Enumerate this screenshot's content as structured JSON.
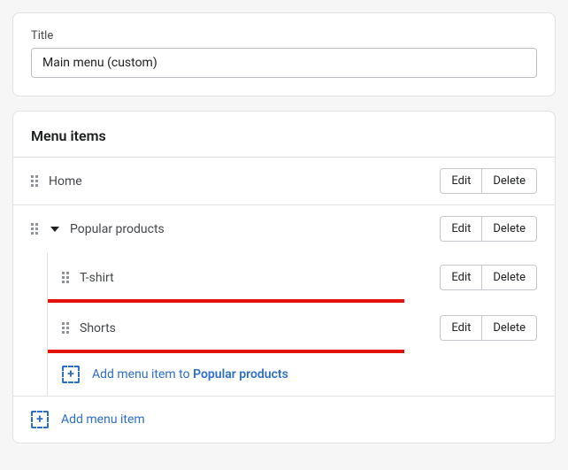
{
  "title_card": {
    "label": "Title",
    "value": "Main menu (custom)"
  },
  "section_header": "Menu items",
  "buttons": {
    "edit": "Edit",
    "delete": "Delete"
  },
  "items": {
    "home": "Home",
    "popular": "Popular products",
    "tshirt": "T-shirt",
    "shorts": "Shorts"
  },
  "add_child": {
    "prefix": "Add menu item to ",
    "target": "Popular products"
  },
  "add_root": "Add menu item"
}
